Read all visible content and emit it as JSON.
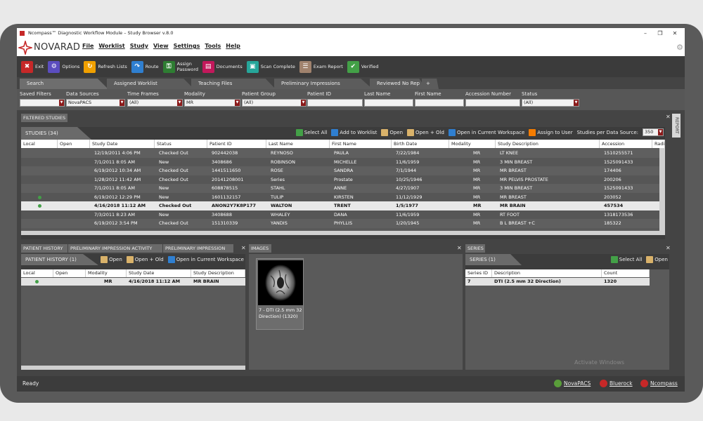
{
  "window": {
    "title": "Ncompass™ Diagnostic Workflow Module – Study Browser v.8.0"
  },
  "brand": {
    "logo_text": "NOVARAD"
  },
  "menu": [
    "File",
    "Worklist",
    "Study",
    "View",
    "Settings",
    "Tools",
    "Help"
  ],
  "toolbar": [
    {
      "label": "Exit",
      "icon": "exit-icon",
      "color": "#c62828"
    },
    {
      "label": "Options",
      "icon": "gear-icon",
      "color": "#5b4dbf"
    },
    {
      "label": "Refresh Lists",
      "icon": "refresh-icon",
      "color": "#f0a000"
    },
    {
      "label": "Route",
      "icon": "route-icon",
      "color": "#2f7fd0"
    },
    {
      "label": "Assign Password",
      "icon": "key-icon",
      "color": "#2e7d32"
    },
    {
      "label": "Documents",
      "icon": "documents-icon",
      "color": "#c2185b"
    },
    {
      "label": "Scan Complete",
      "icon": "scan-icon",
      "color": "#26a69a"
    },
    {
      "label": "Exam Report",
      "icon": "report-icon",
      "color": "#a0826d"
    },
    {
      "label": "Verified",
      "icon": "verified-icon",
      "color": "#43a047"
    }
  ],
  "tabs": [
    "Search",
    "Assigned Worklist",
    "Teaching Files",
    "Preliminary Impressions",
    "Reviewed No Rep",
    "+"
  ],
  "filters": {
    "labels": [
      "Saved Filters",
      "Data Sources",
      "Time Frames",
      "Modality",
      "Patient Group",
      "Patient ID",
      "Last Name",
      "First Name",
      "Accession Number",
      "Status"
    ],
    "values": {
      "saved": "",
      "data_sources": "NovaPACS",
      "time_frames": "(All)",
      "modality": "MR",
      "patient_group": "(All)",
      "patient_id": "",
      "last_name": "",
      "first_name": "",
      "accession": "",
      "status": "(All)"
    }
  },
  "filtered_studies_label": "FILTERED STUDIES",
  "report_label": "REPORT",
  "studies": {
    "title": "STUDIES (34)",
    "actions": [
      "Select All",
      "Add to Worklist",
      "Open",
      "Open + Old",
      "Open in Current Workspace",
      "Assign to User"
    ],
    "per_source_label": "Studies per Data Source:",
    "per_source_value": "350",
    "columns": [
      "Local",
      "Open",
      "Study Date",
      "Status",
      "Patient ID",
      "Last Name",
      "First Name",
      "Birth Date",
      "Modality",
      "Study Description",
      "Accession",
      "Radi"
    ],
    "rows": [
      {
        "local": false,
        "date": "12/19/2011 4:06 PM",
        "status": "Checked Out",
        "pid": "902442038",
        "last": "REYNOSO",
        "first": "PAULA",
        "birth": "7/22/1984",
        "mod": "MR",
        "desc": "LT KNEE",
        "acc": "1510255571"
      },
      {
        "local": false,
        "date": "7/1/2011 8:05 AM",
        "status": "New",
        "pid": "3408686",
        "last": "ROBINSON",
        "first": "MICHELLE",
        "birth": "11/6/1959",
        "mod": "MR",
        "desc": "3 MIN BREAST",
        "acc": "1525091433"
      },
      {
        "local": false,
        "date": "6/19/2012 10:34 AM",
        "status": "Checked Out",
        "pid": "1441511650",
        "last": "ROSE",
        "first": "SANDRA",
        "birth": "7/1/1944",
        "mod": "MR",
        "desc": "MR BREAST",
        "acc": "174406"
      },
      {
        "local": false,
        "date": "1/28/2012 11:42 AM",
        "status": "Checked Out",
        "pid": "20141208001",
        "last": "Series",
        "first": "Prostate",
        "birth": "10/25/1946",
        "mod": "MR",
        "desc": "MR PELVIS PROSTATE",
        "acc": "200206"
      },
      {
        "local": false,
        "date": "7/1/2011 8:05 AM",
        "status": "New",
        "pid": "608878515",
        "last": "STAHL",
        "first": "ANNE",
        "birth": "4/27/1907",
        "mod": "MR",
        "desc": "3 MIN BREAST",
        "acc": "1525091433"
      },
      {
        "local": true,
        "date": "6/19/2012 12:29 PM",
        "status": "New",
        "pid": "1601132157",
        "last": "TULIP",
        "first": "KIRSTEN",
        "birth": "11/12/1929",
        "mod": "MR",
        "desc": "MR BREAST",
        "acc": "203052"
      },
      {
        "local": true,
        "date": "4/16/2018 11:12 AM",
        "status": "Checked Out",
        "pid": "ANON2Y7K8P177",
        "last": "WALTON",
        "first": "TRENT",
        "birth": "1/5/1977",
        "mod": "MR",
        "desc": "MR BRAIN",
        "acc": "457534",
        "selected": true
      },
      {
        "local": false,
        "date": "7/3/2011 8:23 AM",
        "status": "New",
        "pid": "3408688",
        "last": "WHALEY",
        "first": "DANA",
        "birth": "11/6/1959",
        "mod": "MR",
        "desc": "RT FOOT",
        "acc": "1318173536"
      },
      {
        "local": false,
        "date": "6/19/2012 3:54 PM",
        "status": "Checked Out",
        "pid": "151310339",
        "last": "YANDIS",
        "first": "PHYLLIS",
        "birth": "1/20/1945",
        "mod": "MR",
        "desc": "B L BREAST +C",
        "acc": "185322"
      }
    ]
  },
  "bottom_tabs": [
    "PATIENT HISTORY",
    "PRELIMINARY IMPRESSION ACTIVITY",
    "PRELIMINARY IMPRESSION"
  ],
  "patient_history": {
    "title": "PATIENT HISTORY (1)",
    "actions": [
      "Open",
      "Open + Old",
      "Open in Current Workspace"
    ],
    "columns": [
      "Local",
      "Open",
      "Modality",
      "Study Date",
      "Study Description"
    ],
    "rows": [
      {
        "local": true,
        "mod": "MR",
        "date": "4/16/2018 11:12 AM",
        "desc": "MR BRAIN"
      }
    ]
  },
  "images": {
    "title": "IMAGES",
    "thumb_caption": "7 - DTI (2.5 mm 32 Direction) (1320)"
  },
  "series": {
    "tab": "SERIES",
    "title": "SERIES (1)",
    "actions": [
      "Select All",
      "Open"
    ],
    "columns": [
      "Series ID",
      "Description",
      "Count"
    ],
    "rows": [
      {
        "id": "7",
        "desc": "DTI (2.5 mm 32 Direction)",
        "count": "1320"
      }
    ]
  },
  "statusbar": {
    "text": "Ready",
    "links": [
      "NovaPACS",
      "Bluerock",
      "Ncompass"
    ]
  },
  "watermark": "Activate Windows",
  "colors": {
    "accent_red": "#8b1a1a",
    "local_dot": "#43a047",
    "panel_bg": "#3c3c3c"
  }
}
